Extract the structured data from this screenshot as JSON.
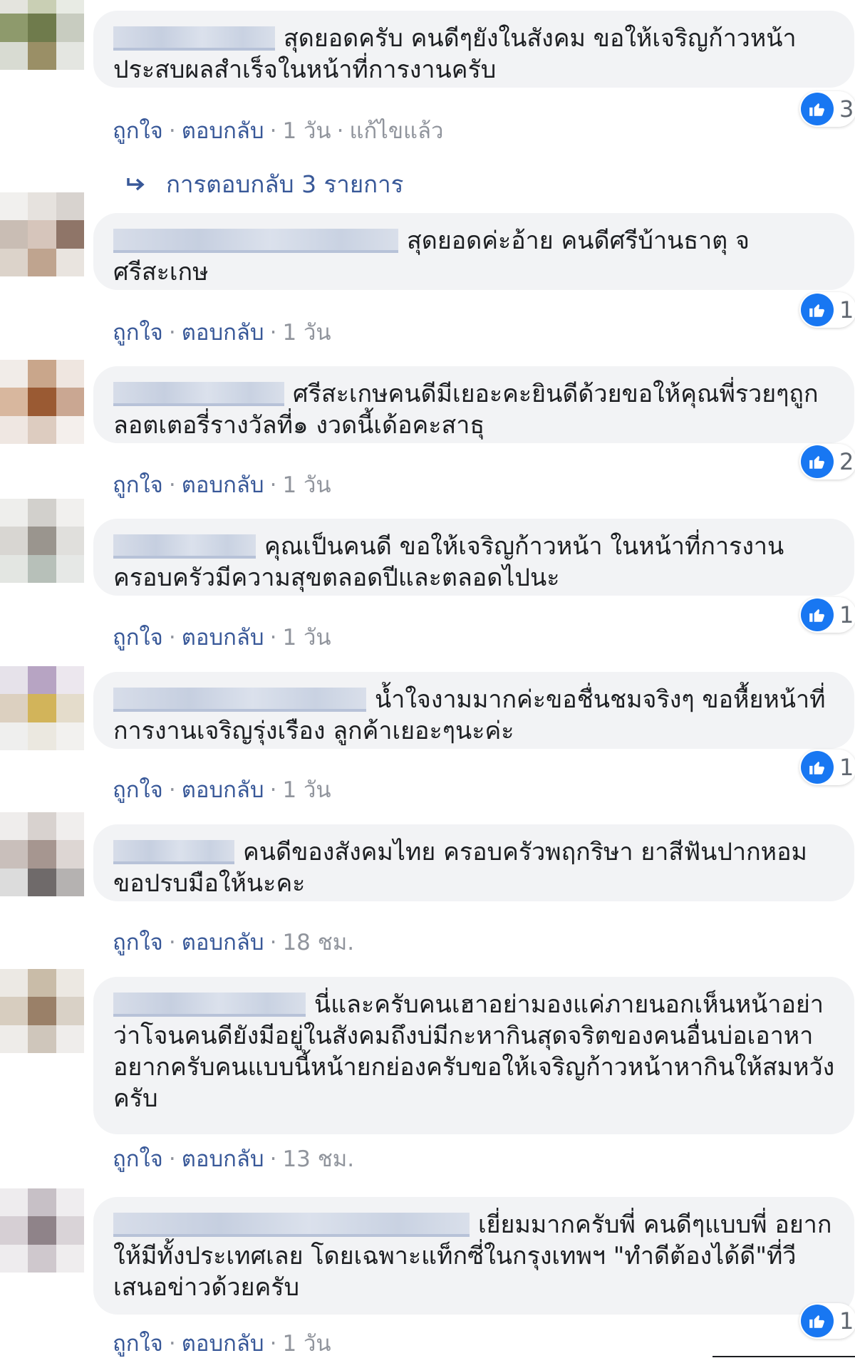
{
  "actions": {
    "like": "ถูกใจ",
    "reply": "ตอบกลับ",
    "dot": "·"
  },
  "comments": [
    {
      "text": "สุดยอดครับ คนดีๆยังในสังคม ขอให้เจริญก้าวหน้าประสบผลสำเร็จในหน้าที่การงานครับ",
      "reactions": "3",
      "time": "1 วัน",
      "edited": "แก้ไขแล้ว",
      "avatar": [
        "#e4e4de",
        "#c9cfb4",
        "#e8ebe4",
        "#8e9a6c",
        "#6f7b4c",
        "#c8ccc0",
        "#d8dbd2",
        "#9a8f66",
        "#e4e6e1"
      ]
    },
    {
      "text": "สุดยอดค่ะอ้าย คนดีศรีบ้านธาตุ จ ศรีสะเกษ",
      "reactions": "1",
      "time": "1 วัน",
      "avatar": [
        "#f1f0ee",
        "#e6e2de",
        "#d8d3cf",
        "#c9bdb4",
        "#d6c5bb",
        "#8f7568",
        "#dcd3ca",
        "#bfa48f",
        "#e9e4df"
      ]
    },
    {
      "text": "ศรีสะเกษคนดีมีเยอะคะยินดีด้วยขอให้คุณพี่รวยๆถูกลอตเตอรี่รางวัลที่๑ งวดนี้เด้อคะสาธุ",
      "reactions": "2",
      "time": "1 วัน",
      "avatar": [
        "#f1ece8",
        "#c9a68b",
        "#efe6e0",
        "#d8b79e",
        "#9a5a33",
        "#caa792",
        "#efe7e2",
        "#ddccc0",
        "#f4efec"
      ]
    },
    {
      "text": "คุณเป็นคนดี ขอให้เจริญก้าวหน้า ในหน้าที่การงาน ครอบครัวมีความสุขตลอดปีและตลอดไปนะ",
      "reactions": "1",
      "time": "1 วัน",
      "avatar": [
        "#eeeeec",
        "#d2d0cc",
        "#f1f0ee",
        "#d8d6d2",
        "#9a958e",
        "#e0dfdc",
        "#e3e6e2",
        "#b7c0b9",
        "#e6e8e6"
      ]
    },
    {
      "text": "น้ำใจงามมากค่ะขอชื่นชมจริงๆ ขอหื้ยหน้าที่การงานเจริญรุ่งเรือง ลูกค้าเยอะๆนะค่ะ",
      "reactions": "1",
      "time": "1 วัน",
      "avatar": [
        "#e6e2ea",
        "#b7a4c3",
        "#ece7ee",
        "#dcd0c0",
        "#d2b45a",
        "#e4dccb",
        "#efefee",
        "#ebe8e0",
        "#f2f1ef"
      ]
    },
    {
      "text": "คนดีของสังคมไทย ครอบครัวพฤกริษา ยาสีฟันปากหอม ขอปรบมือให้นะคะ",
      "reactions": "",
      "time": "18 ชม.",
      "avatar": [
        "#efedec",
        "#d8d2cf",
        "#f0eeed",
        "#c9bfbb",
        "#a69690",
        "#ddd6d3",
        "#dcdcdc",
        "#6f6a6a",
        "#b5b2b1"
      ]
    },
    {
      "text": "นี่และครับคนเฮาอย่ามองแค่ภายนอกเห็นหน้าอย่าว่าโจนคนดียังมีอยู่ในสังคมถึงบ่มีกะหากินสุดจริตของคนอื่นบ่อเอาหาอยากครับคนแบบนี้หน้ายกย่องครับขอให้เจริญก้าวหน้าหากินให้สมหวังครับ",
      "reactions": "",
      "time": "13 ชม.",
      "avatar": [
        "#ece9e4",
        "#c9bca8",
        "#ece8e2",
        "#d7cdbf",
        "#9a8068",
        "#d9d1c6",
        "#eeece9",
        "#cfc6bb",
        "#efedeb"
      ]
    },
    {
      "text": "เยี่ยมมากครับพี่ คนดีๆแบบพี่ อยากให้มีทั้งประเทศเลย โดยเฉพาะแท็กซี่ในกรุงเทพฯ \"ทำดีต้องได้ดี\"ที่วีเสนอข่าวด้วยครับ",
      "reactions": "1",
      "time": "1 วัน",
      "avatar": [
        "#eeecee",
        "#c7c0c6",
        "#efedef",
        "#d6cfd4",
        "#8f8389",
        "#d9d3d7",
        "#eeecee",
        "#cfc8cd",
        "#efedee"
      ]
    }
  ],
  "replies_link": "การตอบกลับ 3 รายการ",
  "icons": {
    "like": "like-thumb-icon",
    "reply_arrow": "reply-arrow-icon"
  },
  "colors": {
    "link": "#385898",
    "bubble": "#f2f3f5",
    "like_blue": "#1877f2",
    "meta": "#90949c"
  }
}
